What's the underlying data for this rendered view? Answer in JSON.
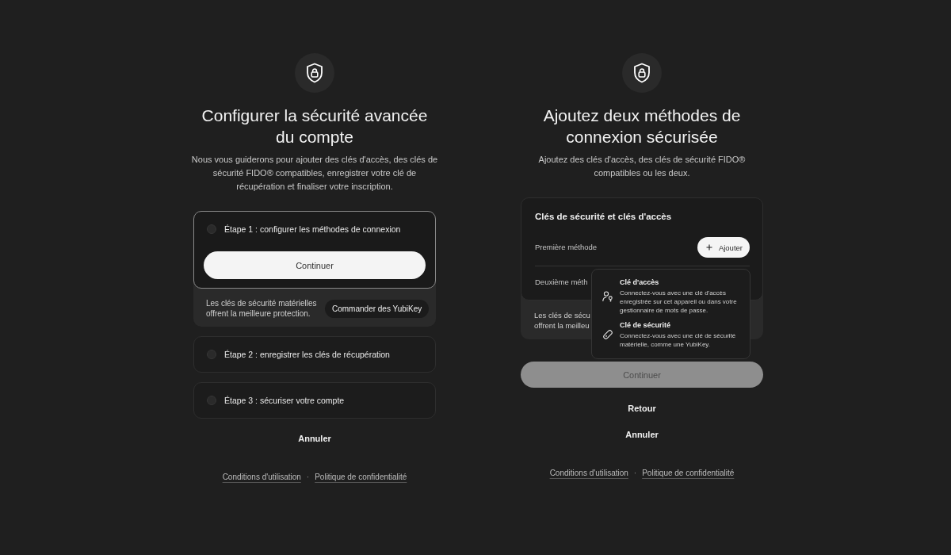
{
  "overview": {
    "title": "Configurer la sécurité avancée du compte",
    "subtitle": "Nous vous guiderons pour ajouter des clés d'accès, des clés de sécurité FIDO® compatibles, enregistrer votre clé de récupération et finaliser votre inscription.",
    "steps": [
      {
        "label": "Étape 1 : configurer les méthodes de connexion",
        "checked": false,
        "expanded": true,
        "button": "Continuer",
        "promo": {
          "text": "Les clés de sécurité matérielles offrent la meilleure protection.",
          "button": "Commander des YubiKey"
        }
      },
      {
        "label": "Étape 2 : enregistrer les clés de récupération",
        "checked": false,
        "expanded": false
      },
      {
        "label": "Étape 3 : sécuriser votre compte",
        "checked": false,
        "expanded": false
      }
    ],
    "cancel_link": "Annuler",
    "footer_links": [
      "Conditions d'utilisation",
      "Politique de confidentialité"
    ],
    "footer_separator": "·"
  },
  "add_methods": {
    "title": "Ajoutez deux méthodes de connexion sécurisée",
    "subtitle": "Ajoutez des clés d'accès, des clés de sécurité FIDO® compatibles ou les deux.",
    "card": {
      "heading": "Clés de sécurité et clés d'accès",
      "methods": [
        {
          "label": "Première méthode",
          "button": "Ajouter"
        },
        {
          "label": "Deuxième méth"
        }
      ],
      "promo_lines": [
        "Les clés de sécu",
        "offrent la meilleu"
      ]
    },
    "menu": {
      "items": [
        {
          "kind": "passkey",
          "title": "Clé d'accès",
          "description": "Connectez-vous avec une clé d'accès enregistrée sur cet appareil ou dans votre gestionnaire de mots de passe."
        },
        {
          "kind": "security_key",
          "title": "Clé de sécurité",
          "description": "Connectez-vous avec une clé de sécurité matérielle, comme une YubiKey."
        }
      ]
    },
    "continue_button": {
      "label": "Continuer",
      "disabled": true
    },
    "back_link": "Retour",
    "cancel_link": "Annuler",
    "footer_links": [
      "Conditions d'utilisation",
      "Politique de confidentialité"
    ],
    "footer_separator": "·"
  }
}
